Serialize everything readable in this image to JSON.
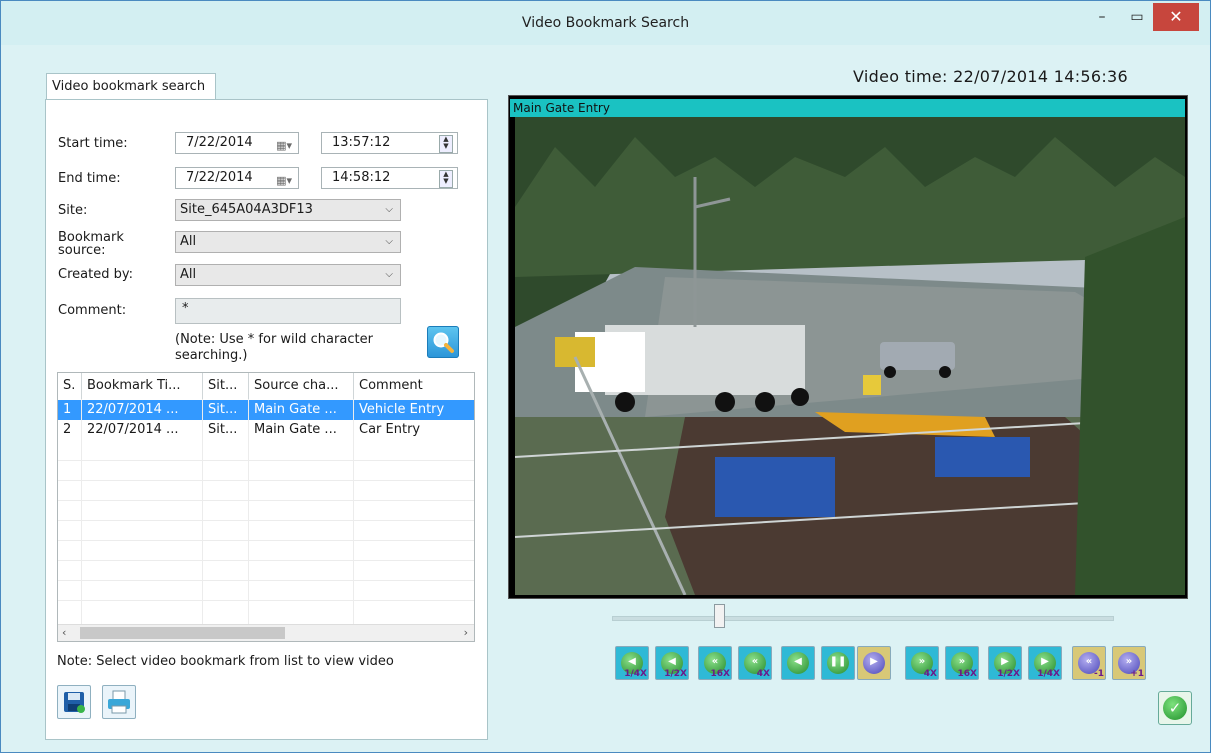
{
  "window": {
    "title": "Video Bookmark Search",
    "min_icon": "minimize-icon",
    "max_icon": "maximize-icon",
    "close_icon": "close-icon"
  },
  "tab": {
    "label": "Video bookmark search"
  },
  "form": {
    "start_label": "Start time:",
    "start_date": "7/22/2014",
    "start_time": "13:57:12",
    "end_label": "End time:",
    "end_date": "7/22/2014",
    "end_time": "14:58:12",
    "site_label": "Site:",
    "site_value": "Site_645A04A3DF13",
    "source_label": "Bookmark source:",
    "source_value": "All",
    "created_label": "Created by:",
    "created_value": "All",
    "comment_label": "Comment:",
    "comment_value": "*",
    "note": "(Note: Use * for wild character searching.)"
  },
  "table": {
    "headers": [
      "S.",
      "Bookmark Ti...",
      "Sit...",
      "Source cha...",
      "Comment"
    ],
    "rows": [
      [
        "1",
        "22/07/2014 ...",
        "Sit...",
        "Main Gate ...",
        "Vehicle Entry"
      ],
      [
        "2",
        "22/07/2014 ...",
        "Sit...",
        "Main Gate ...",
        "Car Entry"
      ]
    ],
    "selected_row": 1
  },
  "bottom_note": "Note: Select video bookmark from list to view video",
  "video": {
    "time_text": "Video time: 22/07/2014 14:56:36",
    "camera_label": "Main Gate Entry",
    "seek_position": 0.21
  },
  "playback_buttons": [
    {
      "icon": "step-back-icon",
      "label": "1/4X"
    },
    {
      "icon": "step-back-icon",
      "label": "1/2X"
    },
    {
      "icon": "rewind-icon",
      "label": "16X"
    },
    {
      "icon": "rewind-icon",
      "label": "4X"
    },
    {
      "icon": "play-reverse-icon",
      "label": ""
    },
    {
      "icon": "pause-icon",
      "label": ""
    },
    {
      "icon": "play-icon",
      "label": ""
    },
    {
      "icon": "fast-forward-icon",
      "label": "4X"
    },
    {
      "icon": "fast-forward-icon",
      "label": "16X"
    },
    {
      "icon": "step-forward-icon",
      "label": "1/2X"
    },
    {
      "icon": "step-forward-icon",
      "label": "1/4X"
    },
    {
      "icon": "prev-frame-icon",
      "label": "-1"
    },
    {
      "icon": "next-frame-icon",
      "label": "+1"
    }
  ],
  "colors": {
    "accent": "#1ac2c2",
    "selection": "#3399ff",
    "close": "#c7463d",
    "background": "#dcf2f4"
  }
}
